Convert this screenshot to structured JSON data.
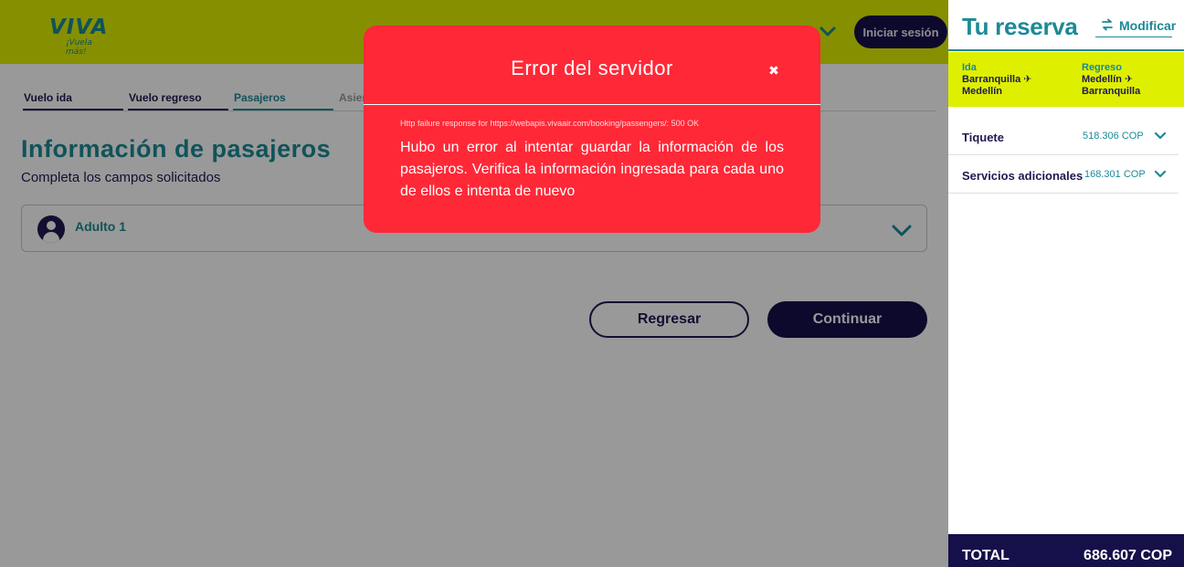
{
  "header": {
    "logo_word": "VIVA",
    "logo_tagline": "¡Vuela más!",
    "login_label": "Iniciar sesión"
  },
  "steps": [
    {
      "label": "Vuelo ida"
    },
    {
      "label": "Vuelo regreso"
    },
    {
      "label": "Pasajeros"
    },
    {
      "label": "Asien"
    }
  ],
  "main": {
    "title": "Información de pasajeros",
    "subtitle": "Completa los campos solicitados",
    "passenger_label": "Adulto 1",
    "back_label": "Regresar",
    "continue_label": "Continuar"
  },
  "modal": {
    "title": "Error del servidor",
    "close_glyph": "✖",
    "detail": "Http failure response for https://webapis.vivaair.com/booking/passengers/: 500 OK",
    "message": "Hubo un error al intentar guardar la información de los pasajeros. Verifica la información ingresada para cada uno de ellos e intenta de nuevo"
  },
  "reservation": {
    "title": "Tu reserva",
    "modify_label": "Modificar",
    "outbound": {
      "kicker": "Ida",
      "from": "Barranquilla ✈",
      "to": "Medellín"
    },
    "return": {
      "kicker": "Regreso",
      "from": "Medellín ✈",
      "to": "Barranquilla"
    },
    "ticket_label": "Tiquete",
    "ticket_value": "518.306 COP",
    "services_label": "Servicios adicionales",
    "services_value": "168.301 COP",
    "total_label": "TOTAL",
    "total_value": "686.607 COP"
  },
  "colors": {
    "brand_yellow": "#dfef00",
    "brand_teal": "#1b8a96",
    "brand_navy": "#16104a",
    "error_red": "#ff2837"
  }
}
